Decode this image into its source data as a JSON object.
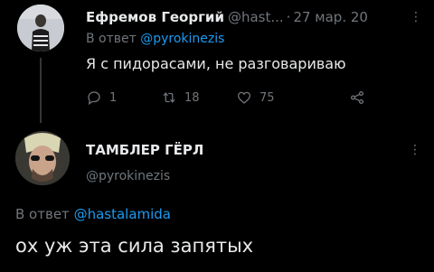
{
  "tweet1": {
    "author_name": "Ефремов Георгий",
    "author_handle": "@hast...",
    "separator": "·",
    "date": "27 мар. 20",
    "more": "⋮",
    "reply_prefix": "В ответ ",
    "reply_mention": "@pyrokinezis",
    "text": "Я с пидорасами, не разговариваю",
    "actions": {
      "reply_count": "1",
      "retweet_count": "18",
      "like_count": "75"
    }
  },
  "tweet2": {
    "author_name": "ТАМБЛЕР ГЁРЛ",
    "author_handle": "@pyrokinezis",
    "more": "⋮",
    "reply_prefix": "В ответ ",
    "reply_mention": "@hastalamida",
    "text": "ох уж эта сила запятых"
  },
  "colors": {
    "background": "#000000",
    "text": "#e7e9ea",
    "muted": "#71767b",
    "link": "#1d9bf0",
    "thread_line": "#333639"
  }
}
